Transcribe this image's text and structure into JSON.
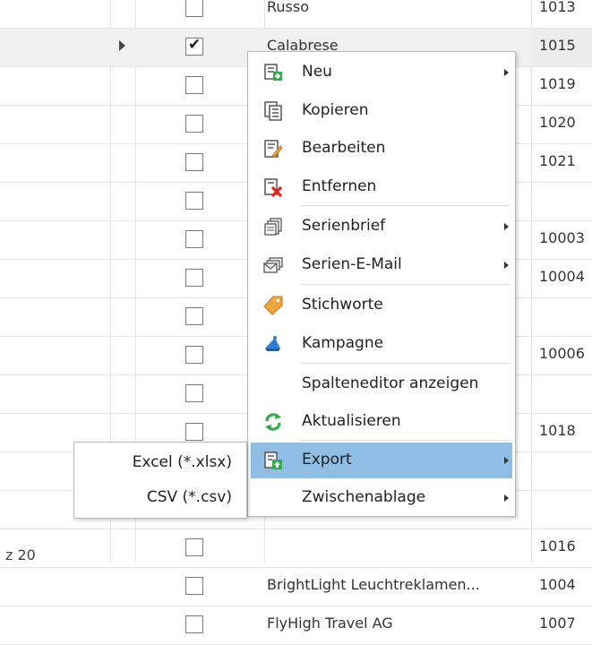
{
  "grid": {
    "rows": [
      {
        "checked": false,
        "name": "Russo",
        "id": "1013"
      },
      {
        "checked": true,
        "name": "Calabrese",
        "id": "1015",
        "selected": true
      },
      {
        "checked": false,
        "name": "",
        "id": "1019"
      },
      {
        "checked": false,
        "name": "",
        "id": "1020"
      },
      {
        "checked": false,
        "name": "",
        "id": "1021"
      },
      {
        "checked": false,
        "name": "",
        "id": ""
      },
      {
        "checked": false,
        "name": "",
        "id": "10003"
      },
      {
        "checked": false,
        "name": "",
        "id": "10004"
      },
      {
        "checked": false,
        "name": "",
        "id": ""
      },
      {
        "checked": false,
        "name": "",
        "id": "10006"
      },
      {
        "checked": false,
        "name": "",
        "id": ""
      },
      {
        "checked": false,
        "name": "",
        "id": "1018"
      },
      {
        "checked": false,
        "name": "",
        "id": ""
      },
      {
        "checked": false,
        "name": "",
        "id": ""
      },
      {
        "checked": false,
        "name": "",
        "id": "1016"
      },
      {
        "checked": false,
        "name": "BrightLight Leuchtreklamen...",
        "id": "1004"
      },
      {
        "checked": false,
        "name": "FlyHigh Travel AG",
        "id": "1007"
      }
    ],
    "footer": "z 20"
  },
  "context_menu": {
    "items": [
      {
        "label": "Neu",
        "icon": "new-record-icon",
        "submenu": true
      },
      {
        "label": "Kopieren",
        "icon": "copy-icon",
        "submenu": false
      },
      {
        "label": "Bearbeiten",
        "icon": "edit-icon",
        "submenu": false
      },
      {
        "label": "Entfernen",
        "icon": "delete-icon",
        "submenu": false
      },
      {
        "label": "Serienbrief",
        "icon": "serial-letter-icon",
        "submenu": true
      },
      {
        "label": "Serien-E-Mail",
        "icon": "serial-email-icon",
        "submenu": true
      },
      {
        "label": "Stichworte",
        "icon": "tag-icon",
        "submenu": false
      },
      {
        "label": "Kampagne",
        "icon": "megaphone-icon",
        "submenu": false
      },
      {
        "label": "Spalteneditor anzeigen",
        "icon": "",
        "submenu": false
      },
      {
        "label": "Aktualisieren",
        "icon": "refresh-icon",
        "submenu": false
      },
      {
        "label": "Export",
        "icon": "export-icon",
        "submenu": true,
        "highlighted": true
      },
      {
        "label": "Zwischenablage",
        "icon": "",
        "submenu": true
      }
    ]
  },
  "export_submenu": {
    "items": [
      {
        "label": "Excel (*.xlsx)"
      },
      {
        "label": "CSV (*.csv)"
      }
    ]
  },
  "colors": {
    "highlight": "#8fbde4",
    "green": "#2eae4b",
    "red": "#e2231a",
    "orange": "#f0a640",
    "blue": "#2a7fd4"
  }
}
